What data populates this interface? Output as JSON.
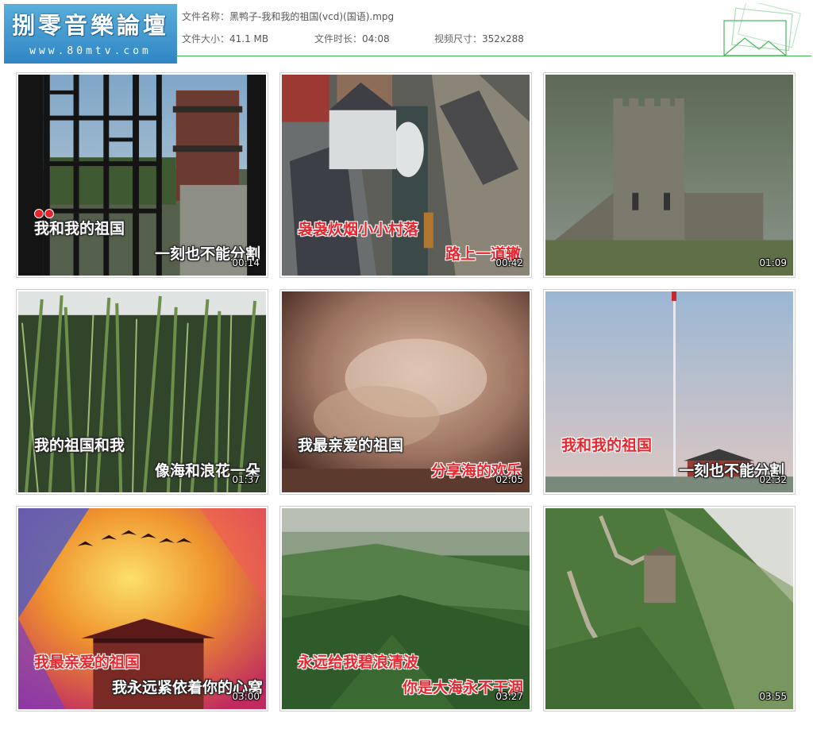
{
  "logo": {
    "title": "捌零音樂論壇",
    "url": "www.80mtv.com"
  },
  "file": {
    "name_label": "文件名称：",
    "name_value": "黑鸭子-我和我的祖国(vcd)(国语).mpg",
    "size_label": "文件大小：",
    "size_value": "41.1 MB",
    "duration_label": "文件时长：",
    "duration_value": "04:08",
    "resolution_label": "视频尺寸：",
    "resolution_value": "352x288"
  },
  "thumbnails": [
    {
      "time": "00:14",
      "subtitles": [
        "我和我的祖国",
        "一刻也不能分割"
      ]
    },
    {
      "time": "00:42",
      "subtitles": [
        "袅袅炊烟小小村落",
        "路上一道辙"
      ]
    },
    {
      "time": "01:09",
      "subtitles": []
    },
    {
      "time": "01:37",
      "subtitles": [
        "我的祖国和我",
        "像海和浪花一朵"
      ]
    },
    {
      "time": "02:05",
      "subtitles": [
        "我最亲爱的祖国",
        "分享海的欢乐"
      ]
    },
    {
      "time": "02:32",
      "subtitles": [
        "我和我的祖国",
        "一刻也不能分割"
      ]
    },
    {
      "time": "03:00",
      "subtitles": [
        "我最亲爱的祖国",
        "我永远紧依着你的心窝"
      ]
    },
    {
      "time": "03:27",
      "subtitles": [
        "永远给我碧浪清波",
        "你是大海永不干涸"
      ]
    },
    {
      "time": "03:55",
      "subtitles": []
    }
  ],
  "colors": {
    "accent_rule": "#3dbb55",
    "logo_bg": "#2f86c4",
    "karaoke_red": "#e8262e"
  }
}
